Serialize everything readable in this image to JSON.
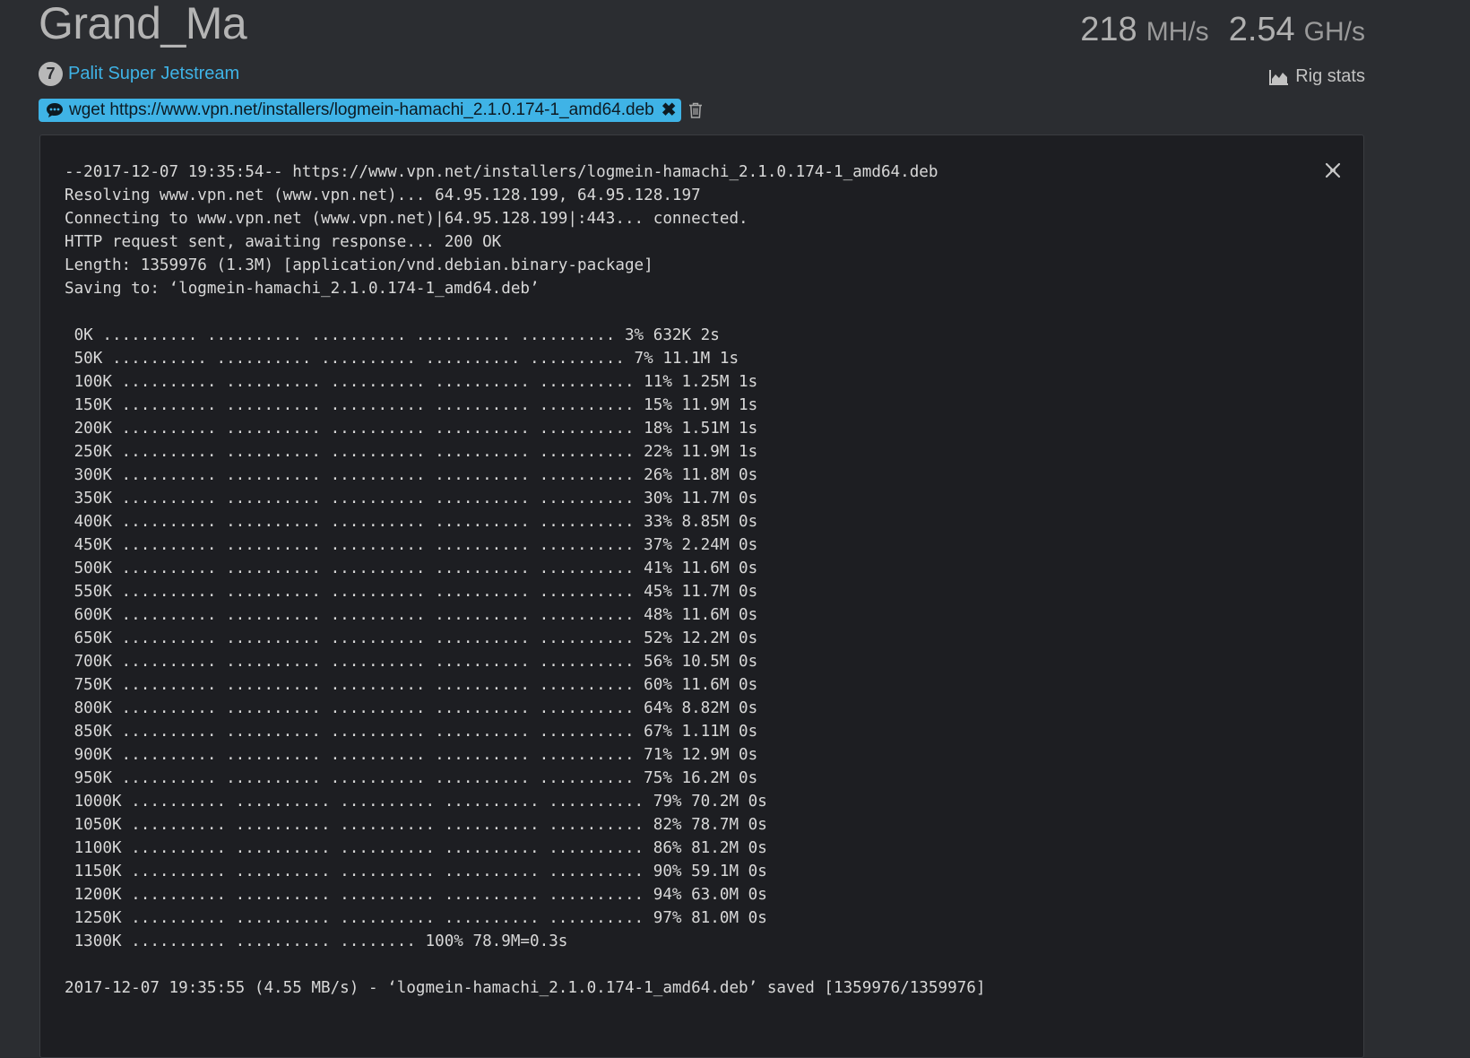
{
  "rig": {
    "name": "Grand_Ma",
    "gpu_count": "7",
    "gpu_model": "Palit Super Jetstream"
  },
  "hashrates": [
    {
      "value": "218",
      "unit": "MH/s"
    },
    {
      "value": "2.54",
      "unit": "GH/s"
    }
  ],
  "links": {
    "rig_stats": "Rig stats"
  },
  "command": {
    "text": "wget https://www.vpn.net/installers/logmein-hamachi_2.1.0.174-1_amd64.deb",
    "close_glyph": "✖"
  },
  "icons": {
    "command": "comment-dots-icon",
    "trash": "trash-icon",
    "stats": "area-chart-icon",
    "close_terminal": "close-icon"
  },
  "terminal": {
    "lines": [
      "--2017-12-07 19:35:54-- https://www.vpn.net/installers/logmein-hamachi_2.1.0.174-1_amd64.deb",
      "Resolving www.vpn.net (www.vpn.net)... 64.95.128.199, 64.95.128.197",
      "Connecting to www.vpn.net (www.vpn.net)|64.95.128.199|:443... connected.",
      "HTTP request sent, awaiting response... 200 OK",
      "Length: 1359976 (1.3M) [application/vnd.debian.binary-package]",
      "Saving to: ‘logmein-hamachi_2.1.0.174-1_amd64.deb’",
      "",
      " 0K .......... .......... .......... .......... .......... 3% 632K 2s",
      " 50K .......... .......... .......... .......... .......... 7% 11.1M 1s",
      " 100K .......... .......... .......... .......... .......... 11% 1.25M 1s",
      " 150K .......... .......... .......... .......... .......... 15% 11.9M 1s",
      " 200K .......... .......... .......... .......... .......... 18% 1.51M 1s",
      " 250K .......... .......... .......... .......... .......... 22% 11.9M 1s",
      " 300K .......... .......... .......... .......... .......... 26% 11.8M 0s",
      " 350K .......... .......... .......... .......... .......... 30% 11.7M 0s",
      " 400K .......... .......... .......... .......... .......... 33% 8.85M 0s",
      " 450K .......... .......... .......... .......... .......... 37% 2.24M 0s",
      " 500K .......... .......... .......... .......... .......... 41% 11.6M 0s",
      " 550K .......... .......... .......... .......... .......... 45% 11.7M 0s",
      " 600K .......... .......... .......... .......... .......... 48% 11.6M 0s",
      " 650K .......... .......... .......... .......... .......... 52% 12.2M 0s",
      " 700K .......... .......... .......... .......... .......... 56% 10.5M 0s",
      " 750K .......... .......... .......... .......... .......... 60% 11.6M 0s",
      " 800K .......... .......... .......... .......... .......... 64% 8.82M 0s",
      " 850K .......... .......... .......... .......... .......... 67% 1.11M 0s",
      " 900K .......... .......... .......... .......... .......... 71% 12.9M 0s",
      " 950K .......... .......... .......... .......... .......... 75% 16.2M 0s",
      " 1000K .......... .......... .......... .......... .......... 79% 70.2M 0s",
      " 1050K .......... .......... .......... .......... .......... 82% 78.7M 0s",
      " 1100K .......... .......... .......... .......... .......... 86% 81.2M 0s",
      " 1150K .......... .......... .......... .......... .......... 90% 59.1M 0s",
      " 1200K .......... .......... .......... .......... .......... 94% 63.0M 0s",
      " 1250K .......... .......... .......... .......... .......... 97% 81.0M 0s",
      " 1300K .......... .......... ........ 100% 78.9M=0.3s",
      "",
      "2017-12-07 19:35:55 (4.55 MB/s) - ‘logmein-hamachi_2.1.0.174-1_amd64.deb’ saved [1359976/1359976]"
    ]
  },
  "colors": {
    "background": "#2b2d31",
    "terminal_bg": "#1d1e22",
    "accent": "#3fb3e6",
    "text_muted": "#b4b4b4"
  }
}
